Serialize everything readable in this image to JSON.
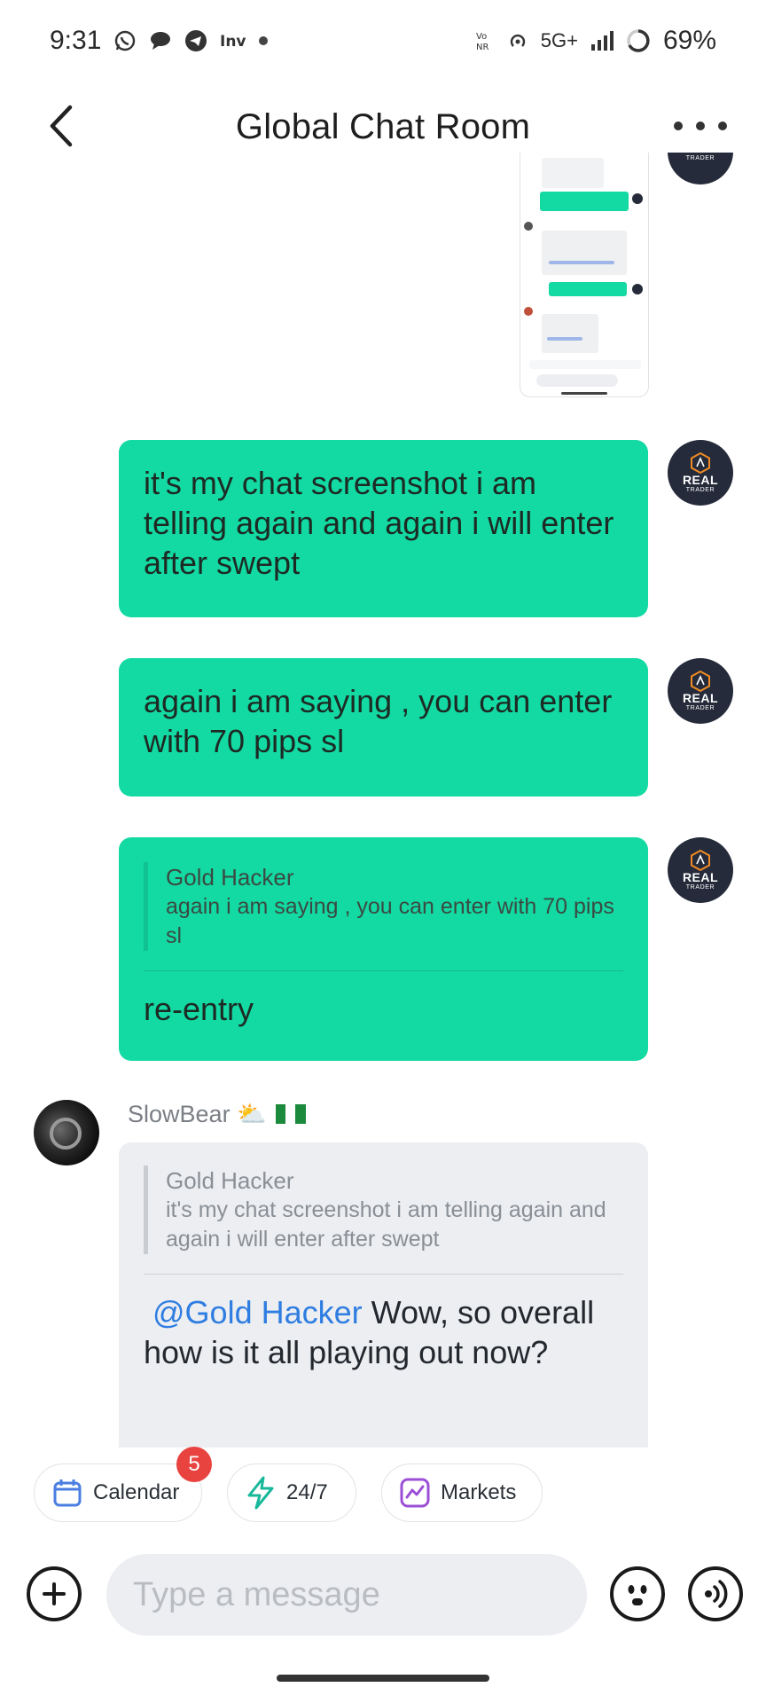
{
  "status_bar": {
    "time": "9:31",
    "network": "5G+",
    "battery": "69%"
  },
  "header": {
    "title": "Global Chat Room"
  },
  "avatar_badge": {
    "line1": "REAL",
    "line2": "TRADER"
  },
  "messages": [
    {
      "id": "m1",
      "type": "image",
      "from_me": true
    },
    {
      "id": "m2",
      "from_me": true,
      "text": "it's my chat screenshot i am telling again and again i will enter after swept"
    },
    {
      "id": "m3",
      "from_me": true,
      "text": "again i am saying , you can enter with 70 pips sl"
    },
    {
      "id": "m4",
      "from_me": true,
      "quote": {
        "name": "Gold Hacker",
        "text": "again i am saying , you can enter with 70 pips sl"
      },
      "text": "re-entry"
    },
    {
      "id": "m5",
      "from_me": false,
      "sender": "SlowBear ⛅",
      "quote": {
        "name": "Gold Hacker",
        "text": "it's my chat screenshot i am telling again and again i will enter after swept"
      },
      "mention": "@Gold Hacker",
      "text": "Wow, so overall how is it all playing out now?"
    }
  ],
  "chips": [
    {
      "label": "Calendar",
      "icon": "calendar-icon",
      "badge": "5",
      "color": "#4a7ee0"
    },
    {
      "label": "24/7",
      "icon": "lightning-icon",
      "color": "#18b89a"
    },
    {
      "label": "Markets",
      "icon": "chart-icon",
      "color": "#9b4fd6"
    }
  ],
  "composer": {
    "placeholder": "Type a message"
  },
  "colors": {
    "my_bubble": "#13d9a3",
    "other_bubble": "#eceef1",
    "mention": "#2f7de1",
    "badge": "#e8433f"
  }
}
